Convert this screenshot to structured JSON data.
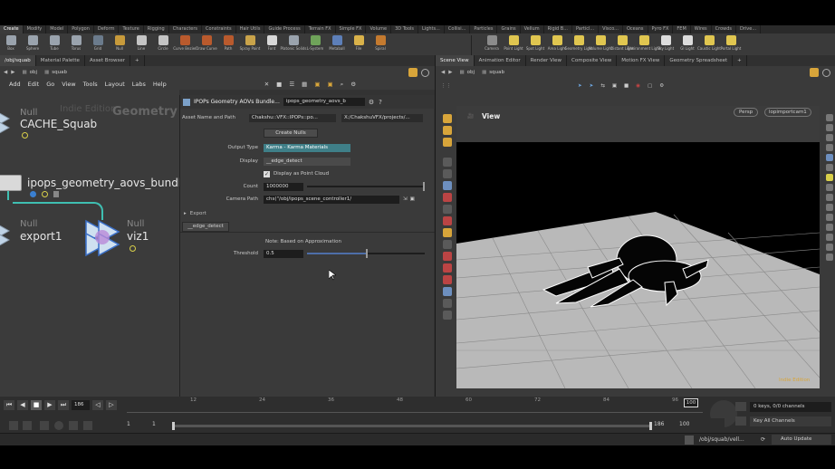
{
  "shelf_tabs": [
    "Create",
    "Modify",
    "Model",
    "Polygon",
    "Deform",
    "Texture",
    "Rigging",
    "Characters",
    "Constraints",
    "Hair Utils",
    "Guide Process",
    "Terrain FX",
    "Simple FX",
    "Volume",
    "3D Tools",
    "Lights...",
    "Collisi...",
    "Particles",
    "Grains",
    "Vellum",
    "Rigid B...",
    "Particl...",
    "Visco...",
    "Oceans",
    "Pyro FX",
    "FEM",
    "Wires",
    "Crowds",
    "Drive..."
  ],
  "shelf_tools_left": [
    {
      "label": "Box",
      "color": "#9aa3ad"
    },
    {
      "label": "Sphere",
      "color": "#9aa3ad"
    },
    {
      "label": "Tube",
      "color": "#9aa3ad"
    },
    {
      "label": "Torus",
      "color": "#9aa3ad"
    },
    {
      "label": "Grid",
      "color": "#6b7b8c"
    },
    {
      "label": "Null",
      "color": "#c79a3b"
    },
    {
      "label": "Line",
      "color": "#c4c4c4"
    },
    {
      "label": "Circle",
      "color": "#c4c4c4"
    },
    {
      "label": "Curve Bezier",
      "color": "#b95a2d"
    },
    {
      "label": "Draw Curve",
      "color": "#b95a2d"
    },
    {
      "label": "Path",
      "color": "#b95a2d"
    },
    {
      "label": "Spray Paint",
      "color": "#c9a34a"
    },
    {
      "label": "Font",
      "color": "#d8d8d8"
    },
    {
      "label": "Platonic Solids",
      "color": "#9aa3ad"
    },
    {
      "label": "L-System",
      "color": "#6fa35a"
    },
    {
      "label": "Metaball",
      "color": "#5d7fb8"
    },
    {
      "label": "File",
      "color": "#d9b24a"
    },
    {
      "label": "Spiral",
      "color": "#c47a2f"
    }
  ],
  "shelf_tools_right": [
    {
      "label": "Camera",
      "color": "#8b8b8b"
    },
    {
      "label": "Point Light",
      "color": "#e0c650"
    },
    {
      "label": "Spot Light",
      "color": "#e0c650"
    },
    {
      "label": "Area Light",
      "color": "#e0c650"
    },
    {
      "label": "Geometry Light",
      "color": "#e0c650"
    },
    {
      "label": "Volume Light",
      "color": "#e0c650"
    },
    {
      "label": "Distant Light",
      "color": "#e0c650"
    },
    {
      "label": "Environment Light",
      "color": "#e0c650"
    },
    {
      "label": "Sky Light",
      "color": "#dcdcdc"
    },
    {
      "label": "GI Light",
      "color": "#dcdcdc"
    },
    {
      "label": "Caustic Light",
      "color": "#e0c650"
    },
    {
      "label": "Portal Light",
      "color": "#e0c650"
    }
  ],
  "left_tabs": [
    "/obj/squab",
    "Material Palette",
    "Asset Browser"
  ],
  "path": {
    "root": "obj",
    "node": "squab"
  },
  "menu": [
    "Add",
    "Edit",
    "Go",
    "View",
    "Tools",
    "Layout",
    "Labs",
    "Help"
  ],
  "network": {
    "watermark_edition": "Indie Edition",
    "watermark_context": "Geometry",
    "nodes": [
      {
        "type": "Null",
        "name": "CACHE_Squab"
      },
      {
        "type": "",
        "name": "ipops_geometry_aovs_bundle"
      },
      {
        "type": "Null",
        "name": "export1"
      },
      {
        "type": "Null",
        "name": "viz1"
      }
    ]
  },
  "params": {
    "title": "IPOPs Geometry AOVs Bundle...",
    "node_field": "ipops_geometry_aovs_b",
    "asset_label": "Asset Name and Path",
    "asset_name": "Chakshu::VFX::IPOPs::po...",
    "asset_path": "X:/ChakshuVFX/projects/...",
    "create_nulls": "Create Nulls",
    "output_type_label": "Output Type",
    "output_type_value": "Karma - Karma Materials",
    "display_label": "Display",
    "display_value": "__edge_detect",
    "point_cloud_label": "Display as Point Cloud",
    "count_label": "Count",
    "count_value": "1000000",
    "camera_label": "Camera Path",
    "camera_value": "chs(\"/obj/ipops_scene_controller1/",
    "export_label": "Export",
    "section_tab": "__edge_detect",
    "note": "Note: Based on Approximation",
    "threshold_label": "Threshold",
    "threshold_value": "0.5",
    "threshold_fraction": 0.5
  },
  "viewer_tabs": [
    "Scene View",
    "Animation Editor",
    "Render View",
    "Composite View",
    "Motion FX View",
    "Geometry Spreadsheet"
  ],
  "viewport": {
    "title": "View",
    "persp": "Persp",
    "camera": "lopimportcam1",
    "edition": "Indie Edition"
  },
  "timeline": {
    "current_frame": "186",
    "ticks": [
      "12",
      "24",
      "36",
      "48",
      "60",
      "72",
      "84",
      "96"
    ],
    "end_marker": "100",
    "range_start": "1",
    "range_start2": "1",
    "range_end": "186",
    "range_end2": "100",
    "keys_text": "0 keys, 0/0 channels",
    "key_all": "Key All Channels",
    "status_path": "/obj/squab/vell...",
    "auto_update": "Auto Update"
  }
}
